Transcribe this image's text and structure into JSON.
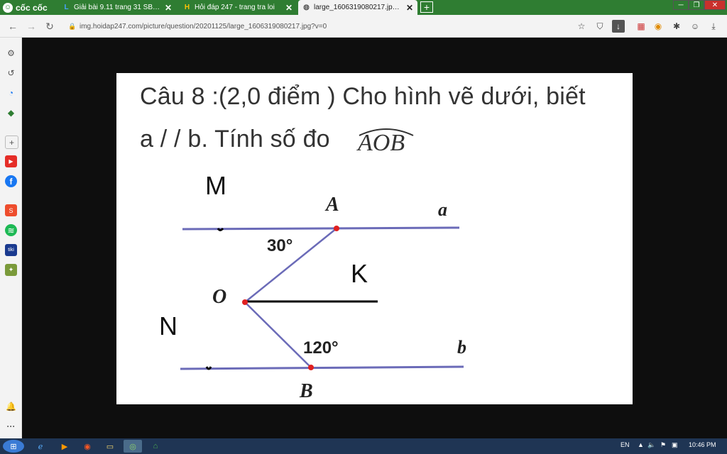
{
  "browser": {
    "brand": "cốc cốc",
    "tabs": [
      {
        "icon": "L",
        "title": "Giải bài 9.11 trang 31 SBT vậ",
        "active": false
      },
      {
        "icon": "H",
        "title": "Hỏi đáp 247 - trang tra loi",
        "active": false
      },
      {
        "icon": "globe-icon",
        "title": "large_1606319080217.jpg (10",
        "active": true
      }
    ],
    "new_tab": "+",
    "url": "img.hoidap247.com/picture/question/20201125/large_1606319080217.jpg?v=0"
  },
  "question": {
    "line1": "Câu 8 :(2,0 điểm ) Cho hình vẽ dưới, biết",
    "line2": "a / / b. Tính số đo",
    "angle_expr": "AOB"
  },
  "figure": {
    "labels": {
      "A": "A",
      "O": "O",
      "B": "B",
      "a": "a",
      "b": "b"
    },
    "angle_top": "30°",
    "angle_bottom": "120°",
    "handwritten": {
      "M": "M",
      "N": "N",
      "K": "K"
    }
  },
  "taskbar": {
    "lang": "EN",
    "time": "10:46 PM"
  },
  "colors": {
    "tab_bar": "#2f7d32",
    "line": "#6b6bb8",
    "point": "#e02020"
  }
}
